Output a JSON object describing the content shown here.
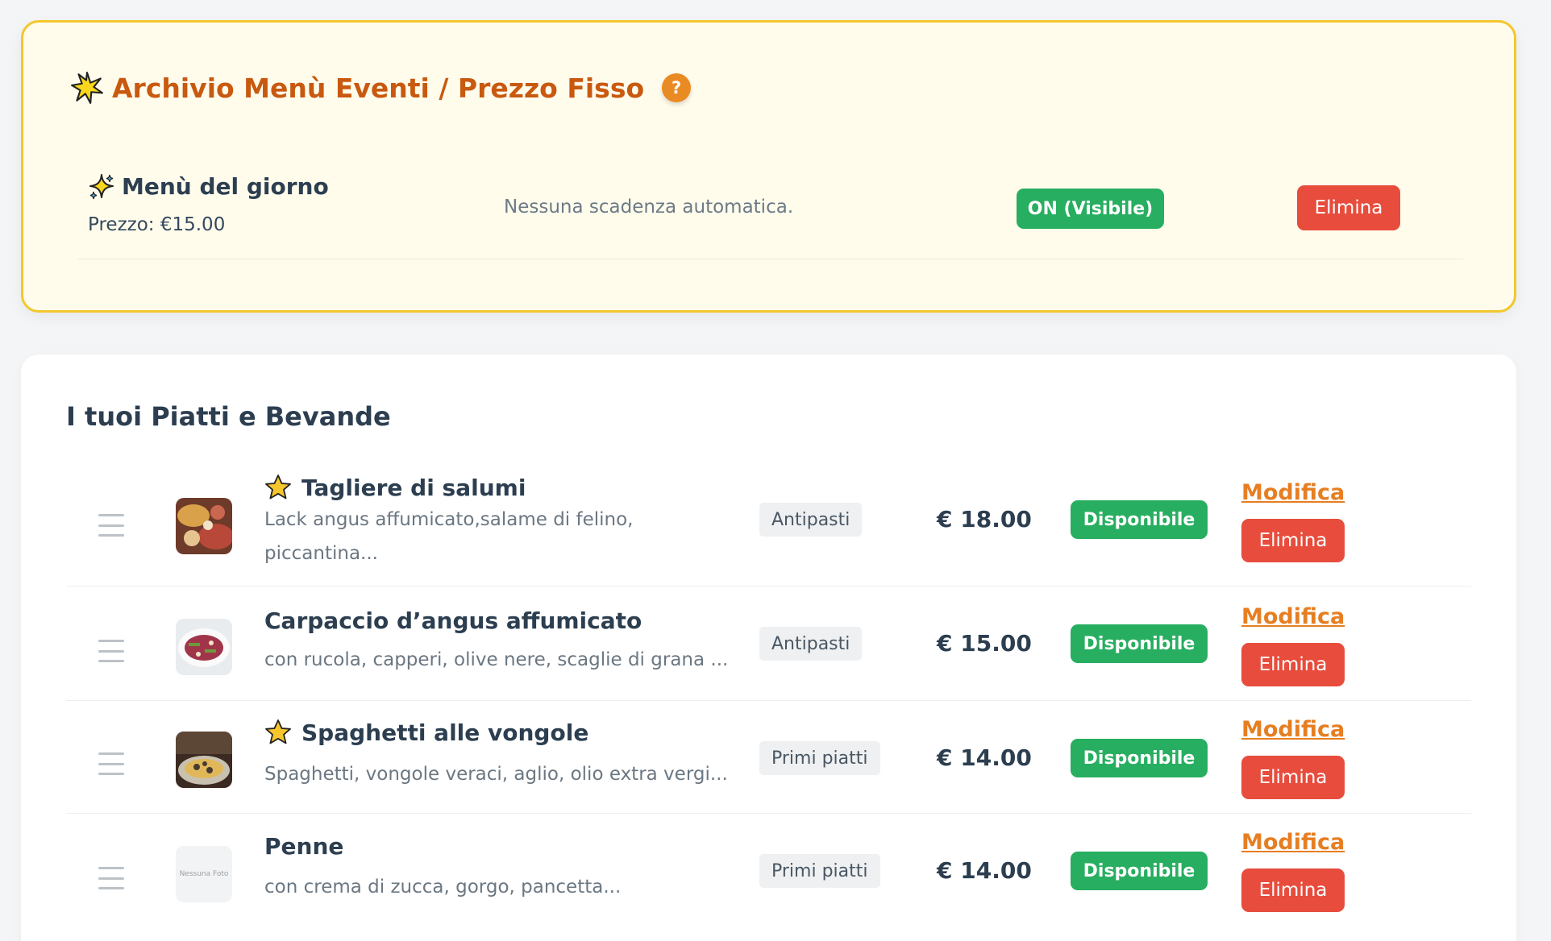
{
  "events": {
    "title": "Archivio Menù Eventi / Prezzo Fisso",
    "help_label": "?",
    "items": [
      {
        "name": "Menù del giorno",
        "price": "Prezzo: €15.00",
        "expiry": "Nessuna scadenza automatica.",
        "status_label": "ON (Visibile)",
        "delete_label": "Elimina"
      }
    ]
  },
  "dishes": {
    "title": "I tuoi Piatti e Bevande",
    "items": [
      {
        "name": "Tagliere di salumi",
        "featured": true,
        "description": "Lack angus affumicato,salame di felino, piccantina...",
        "category": "Antipasti",
        "price": "€ 18.00",
        "status_label": "Disponibile",
        "edit_label": "Modifica",
        "delete_label": "Elimina"
      },
      {
        "name": "Carpaccio d’angus affumicato",
        "featured": false,
        "description": "con rucola, capperi, olive nere, scaglie di grana ...",
        "category": "Antipasti",
        "price": "€ 15.00",
        "status_label": "Disponibile",
        "edit_label": "Modifica",
        "delete_label": "Elimina"
      },
      {
        "name": "Spaghetti alle vongole",
        "featured": true,
        "description": "Spaghetti, vongole veraci, aglio, olio extra vergi...",
        "category": "Primi piatti",
        "price": "€ 14.00",
        "status_label": "Disponibile",
        "edit_label": "Modifica",
        "delete_label": "Elimina"
      },
      {
        "name": "Penne",
        "featured": false,
        "no_photo_label": "Nessuna Foto",
        "description": "con crema di zucca, gorgo, pancetta...",
        "category": "Primi piatti",
        "price": "€ 14.00",
        "status_label": "Disponibile",
        "edit_label": "Modifica",
        "delete_label": "Elimina"
      }
    ]
  },
  "colors": {
    "accent_orange": "#c8590f",
    "success_green": "#27ae60",
    "danger_red": "#e74c3c",
    "events_border": "#f3c72d",
    "events_background": "#fffcec"
  }
}
